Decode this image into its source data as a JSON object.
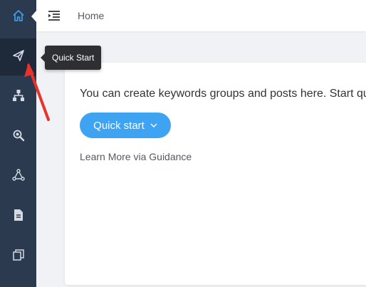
{
  "header": {
    "breadcrumb": "Home"
  },
  "sidebar": {
    "items": [
      {
        "name": "home",
        "icon": "home-icon",
        "active_color": "#3ea4f1"
      },
      {
        "name": "quick-start",
        "icon": "paper-plane-icon"
      },
      {
        "name": "groups",
        "icon": "org-chart-icon"
      },
      {
        "name": "search",
        "icon": "magnifier-icon"
      },
      {
        "name": "network",
        "icon": "network-icon"
      },
      {
        "name": "documents",
        "icon": "document-icon"
      },
      {
        "name": "copies",
        "icon": "copy-icon"
      }
    ],
    "background": "#2b3a4e"
  },
  "tooltip": {
    "text": "Quick Start"
  },
  "card": {
    "intro": "You can create keywords groups and posts here. Start qu",
    "button_label": "Quick start",
    "learn_more": "Learn More via Guidance"
  },
  "colors": {
    "accent": "#3ea4f1",
    "annotation": "#e8322b"
  }
}
